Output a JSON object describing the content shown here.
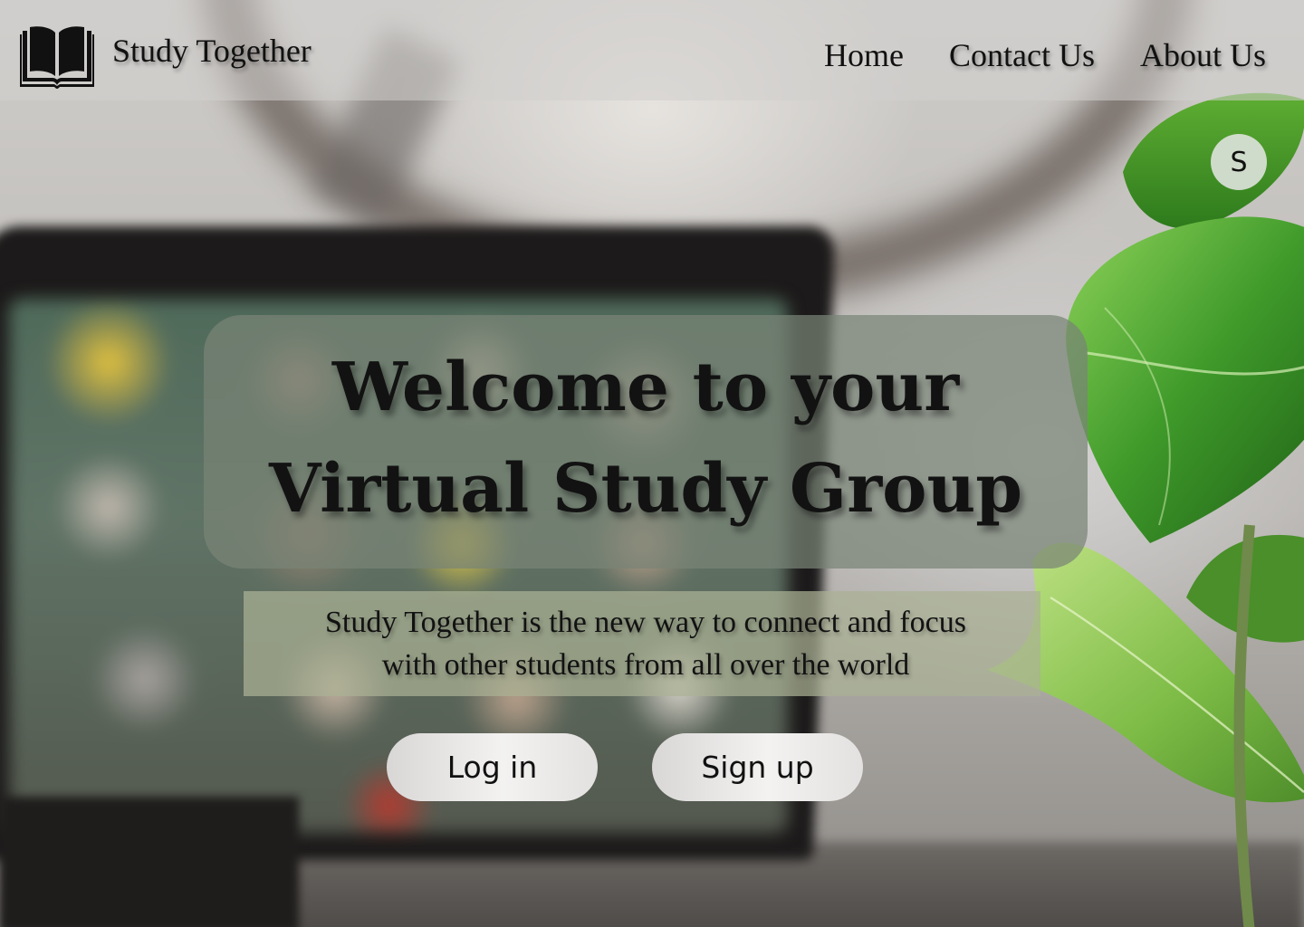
{
  "brand": {
    "name": "Study Together",
    "icon": "open-book-icon"
  },
  "nav": {
    "items": [
      {
        "label": "Home"
      },
      {
        "label": "Contact Us"
      },
      {
        "label": "About Us"
      }
    ]
  },
  "user": {
    "avatar_initial": "S"
  },
  "hero": {
    "title_line1": "Welcome to your",
    "title_line2": "Virtual Study Group",
    "subtitle_line1": "Study Together is the new way to connect and focus",
    "subtitle_line2": "with other students from all over the world"
  },
  "actions": {
    "login_label": "Log in",
    "signup_label": "Sign up"
  },
  "colors": {
    "hero_card": "#788476",
    "sub_card": "#aab294",
    "button": "#f0efee",
    "text": "#121212"
  }
}
